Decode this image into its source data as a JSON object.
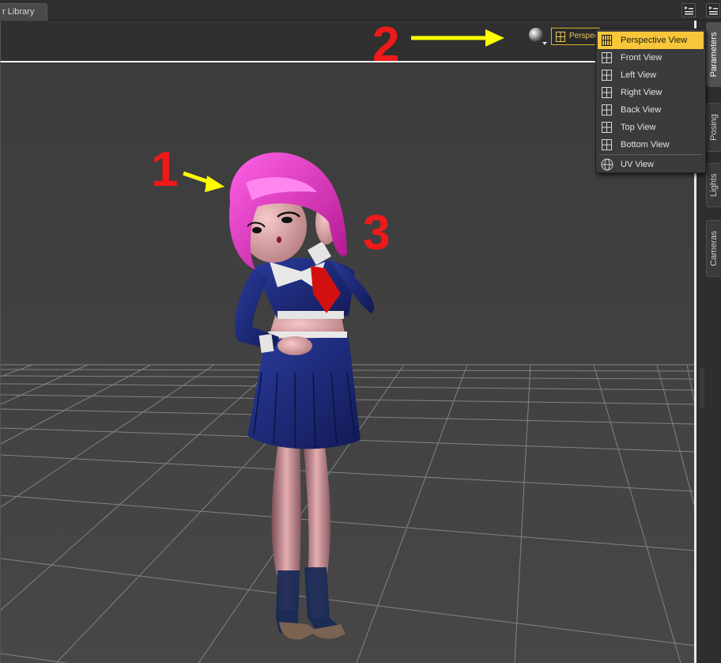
{
  "window": {
    "tab_label": "r Library"
  },
  "toolbar": {
    "view_select_text": "Perspective View",
    "shading_icon": "sphere-icon"
  },
  "view_menu": {
    "items": [
      {
        "label": "Perspective View",
        "icon": "camera-grid-icon",
        "selected": true
      },
      {
        "label": "Front View",
        "icon": "camera-grid-icon",
        "selected": false
      },
      {
        "label": "Left View",
        "icon": "camera-grid-icon",
        "selected": false
      },
      {
        "label": "Right View",
        "icon": "camera-grid-icon",
        "selected": false
      },
      {
        "label": "Back View",
        "icon": "camera-grid-icon",
        "selected": false
      },
      {
        "label": "Top View",
        "icon": "camera-grid-icon",
        "selected": false
      },
      {
        "label": "Bottom View",
        "icon": "camera-grid-icon",
        "selected": false
      }
    ],
    "uv_item": {
      "label": "UV View",
      "icon": "globe-icon"
    }
  },
  "dock_tabs": [
    {
      "label": "Parameters",
      "active": true
    },
    {
      "label": "Posing",
      "active": false
    },
    {
      "label": "Lights",
      "active": false
    },
    {
      "label": "Cameras",
      "active": false
    }
  ],
  "annotations": {
    "n1": "1",
    "n2": "2",
    "n3": "3",
    "color": "#ee1a1a",
    "arrow_color": "#ffff00"
  },
  "colors": {
    "accent": "#f7c63a",
    "viewport_bg": "#3f3f3f",
    "panel_bg": "#303030"
  }
}
